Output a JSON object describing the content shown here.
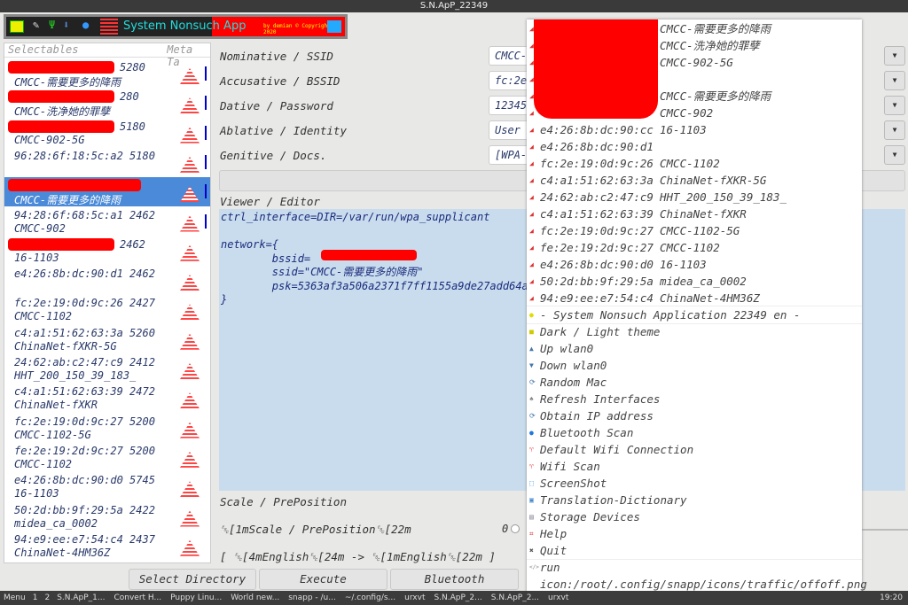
{
  "window_title": "S.N.ApP_22349",
  "banner": {
    "title": "System Nonsuch App",
    "copyright": "by demian © Copyright 2020"
  },
  "left": {
    "headers": [
      "Selectables",
      "Meta Ta"
    ],
    "items": [
      {
        "line1": "5280",
        "line2": "CMCC-需要更多的降雨",
        "redacted": true
      },
      {
        "line1": "280",
        "line2": "CMCC-洗净她的罪孽",
        "redacted": true
      },
      {
        "line1": "5180",
        "line2": "CMCC-902-5G",
        "redacted": true
      },
      {
        "line1": "96:28:6f:18:5c:a2 5180",
        "line2": "",
        "redacted": false
      },
      {
        "line1": "",
        "line2": "CMCC-需要更多的降雨",
        "redacted": true,
        "selected": true
      },
      {
        "line1": "94:28:6f:68:5c:a1 2462",
        "line2": "CMCC-902",
        "redacted": false
      },
      {
        "line1": "2462",
        "line2": "16-1103",
        "redacted": true
      },
      {
        "line1": "e4:26:8b:dc:90:d1 2462",
        "line2": "",
        "redacted": false
      },
      {
        "line1": "fc:2e:19:0d:9c:26 2427",
        "line2": "CMCC-1102"
      },
      {
        "line1": "c4:a1:51:62:63:3a 5260",
        "line2": "ChinaNet-fXKR-5G"
      },
      {
        "line1": "24:62:ab:c2:47:c9 2412",
        "line2": "HHT_200_150_39_183_"
      },
      {
        "line1": "c4:a1:51:62:63:39 2472",
        "line2": "ChinaNet-fXKR"
      },
      {
        "line1": "fc:2e:19:0d:9c:27 5200",
        "line2": "CMCC-1102-5G"
      },
      {
        "line1": "fe:2e:19:2d:9c:27 5200",
        "line2": "CMCC-1102"
      },
      {
        "line1": "e4:26:8b:dc:90:d0 5745",
        "line2": "16-1103"
      },
      {
        "line1": "50:2d:bb:9f:29:5a 2422",
        "line2": "midea_ca_0002"
      },
      {
        "line1": "94:e9:ee:e7:54:c4 2437",
        "line2": "ChinaNet-4HM36Z"
      }
    ]
  },
  "form": [
    {
      "label": "Nominative / SSID",
      "value": "CMCC-"
    },
    {
      "label": "Accusative / BSSID",
      "value": "fc:2e"
    },
    {
      "label": "Dative / Password",
      "value": "12345"
    },
    {
      "label": "Ablative / Identity",
      "value": "User"
    },
    {
      "label": "Genitive / Docs.",
      "value": "[WPA-"
    }
  ],
  "apply_label": "A",
  "viewer_label": "Viewer / Editor",
  "editor_text": "ctrl_interface=DIR=/var/run/wpa_supplicant\n\nnetwork={\n        bssid=\n        ssid=\"CMCC-需要更多的降雨\"\n        psk=5363af3a506a2371f7ff1155a9de27add64ac\n}",
  "scale": {
    "label": "Scale / PrePosition",
    "line1": "␛[1mScale / PrePosition␛[22m",
    "line2": "[ ␛[4mEnglish␛[24m -> ␛[1mEnglish␛[22m ]",
    "slider_value": "0"
  },
  "buttons": [
    "Select Directory",
    "Execute",
    "Bluetooth"
  ],
  "menu": {
    "networks": [
      {
        "mac": "",
        "ssid": "CMCC-需要更多的降雨"
      },
      {
        "mac": "",
        "ssid": "CMCC-洗净她的罪孽"
      },
      {
        "mac": "",
        "ssid": "CMCC-902-5G"
      },
      {
        "mac": "",
        "ssid": ""
      },
      {
        "mac": "",
        "ssid": "CMCC-需要更多的降雨"
      },
      {
        "mac": "",
        "ssid": "CMCC-902"
      },
      {
        "mac": "e4:26:8b:dc:90:cc",
        "ssid": "16-1103"
      },
      {
        "mac": "e4:26:8b:dc:90:d1",
        "ssid": ""
      },
      {
        "mac": "fc:2e:19:0d:9c:26",
        "ssid": "CMCC-1102"
      },
      {
        "mac": "c4:a1:51:62:63:3a",
        "ssid": "ChinaNet-fXKR-5G"
      },
      {
        "mac": "24:62:ab:c2:47:c9",
        "ssid": "HHT_200_150_39_183_"
      },
      {
        "mac": "c4:a1:51:62:63:39",
        "ssid": "ChinaNet-fXKR"
      },
      {
        "mac": "fc:2e:19:0d:9c:27",
        "ssid": "CMCC-1102-5G"
      },
      {
        "mac": "fe:2e:19:2d:9c:27",
        "ssid": "CMCC-1102"
      },
      {
        "mac": "e4:26:8b:dc:90:d0",
        "ssid": "16-1103"
      },
      {
        "mac": "50:2d:bb:9f:29:5a",
        "ssid": "midea_ca_0002"
      },
      {
        "mac": "94:e9:ee:e7:54:c4",
        "ssid": "ChinaNet-4HM36Z"
      }
    ],
    "header": "- System Nonsuch Application 22349 en -",
    "actions": [
      {
        "label": "Dark / Light theme",
        "icon": "theme-icon",
        "glyph": "■",
        "color": "#cc0"
      },
      {
        "label": "Up wlan0",
        "icon": "up-arrow-icon",
        "glyph": "▲",
        "color": "#47a"
      },
      {
        "label": "Down wlan0",
        "icon": "down-arrow-icon",
        "glyph": "▼",
        "color": "#47a"
      },
      {
        "label": "Random Mac",
        "icon": "refresh-icon",
        "glyph": "⟳",
        "color": "#47a"
      },
      {
        "label": "Refresh Interfaces",
        "icon": "tree-icon",
        "glyph": "♠",
        "color": "#888"
      },
      {
        "label": "Obtain IP address",
        "icon": "refresh-icon",
        "glyph": "⟳",
        "color": "#47a"
      },
      {
        "label": "Bluetooth Scan",
        "icon": "bluetooth-icon",
        "glyph": "●",
        "color": "#27d"
      },
      {
        "label": "Default Wifi Connection",
        "icon": "wifi-icon",
        "glyph": "♈",
        "color": "#e55"
      },
      {
        "label": "Wifi Scan",
        "icon": "wifi-icon",
        "glyph": "♈",
        "color": "#e55"
      },
      {
        "label": "ScreenShot",
        "icon": "screenshot-icon",
        "glyph": "⬚",
        "color": "#28d"
      },
      {
        "label": "Translation-Dictionary",
        "icon": "dictionary-icon",
        "glyph": "▣",
        "color": "#48c"
      },
      {
        "label": "Storage Devices",
        "icon": "storage-icon",
        "glyph": "▤",
        "color": "#889"
      },
      {
        "label": "Help",
        "icon": "help-icon",
        "glyph": "⌗",
        "color": "#d33"
      },
      {
        "label": "Quit",
        "icon": "quit-icon",
        "glyph": "✖",
        "color": "#555"
      }
    ],
    "run": "run",
    "run_path": "icon:/root/.config/snapp/icons/traffic/offoff.png"
  },
  "taskbar": {
    "menu": "Menu",
    "workspaces": [
      "1",
      "2"
    ],
    "tasks": [
      "S.N.ApP_1...",
      "Convert H...",
      "Puppy Linu...",
      "World new...",
      "snapp - /u...",
      "~/.config/s...",
      "urxvt",
      "S.N.ApP_2...",
      "S.N.ApP_2...",
      "urxvt"
    ],
    "clock": "19:20"
  }
}
